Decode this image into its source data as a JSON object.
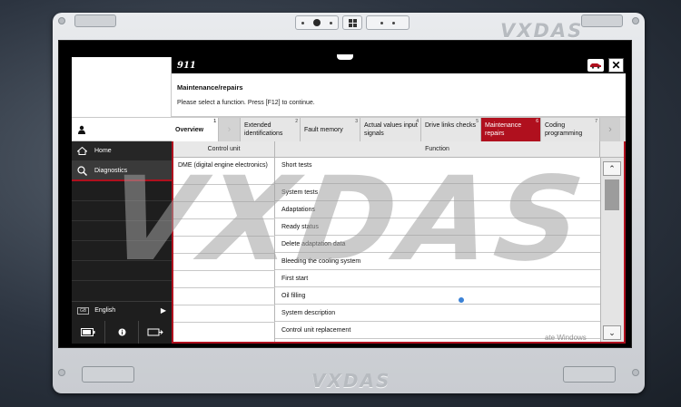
{
  "brand": "VXDAS",
  "watermark": "VXDAS",
  "activate_text": "ate Windows",
  "header": {
    "car_model": "911",
    "heading": "Maintenance/repairs",
    "instruction": "Please select a function. Press [F12] to continue."
  },
  "nav": {
    "home": "Home",
    "diagnostics": "Diagnostics",
    "language": "English",
    "language_flag": "GB"
  },
  "tabs": [
    {
      "label": "Overview",
      "num": "1"
    },
    {
      "label": "Extended identifications",
      "num": "2"
    },
    {
      "label": "Fault memory",
      "num": "3"
    },
    {
      "label": "Actual values input signals",
      "num": "4"
    },
    {
      "label": "Drive links checks",
      "num": "5"
    },
    {
      "label": "Maintenance repairs",
      "num": "6",
      "active": true
    },
    {
      "label": "Coding programming",
      "num": "7"
    }
  ],
  "table": {
    "col_control_unit": "Control unit",
    "col_function": "Function",
    "control_unit": "DME (digital engine electronics)",
    "functions": [
      "Short tests",
      "System tests",
      "Adaptations",
      "Ready status",
      "Delete adaptation data",
      "Bleeding the cooling system",
      "First start",
      "Oil filling",
      "System description",
      "Control unit replacement"
    ]
  },
  "colors": {
    "accent": "#b0101e",
    "nav_bg": "#1e1e1e"
  },
  "icons": [
    "user-icon",
    "home-icon",
    "diagnostics-icon",
    "battery-icon",
    "info-icon",
    "car-connect-icon",
    "car-icon",
    "close-icon",
    "scroll-up-icon",
    "scroll-down-icon"
  ]
}
